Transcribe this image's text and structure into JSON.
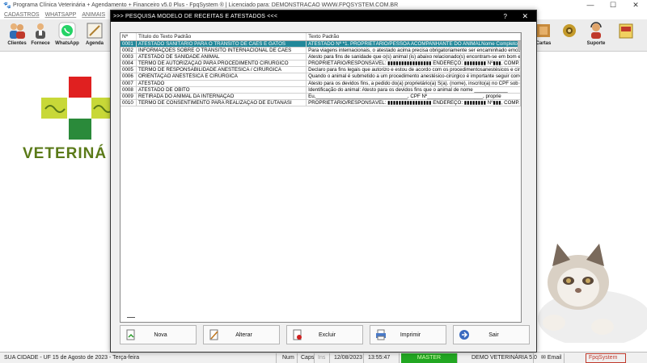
{
  "window": {
    "title": "Programa Clínica Veterinária + Agendamento + Financeiro v5.0 Plus - FpqSystem ® | Licenciado para: DEMONSTRACAO WWW.FPQSYSTEM.COM.BR",
    "minimize": "—",
    "maximize": "☐",
    "close": "✕"
  },
  "menu": [
    "CADASTROS",
    "WHATSAPP",
    "ANIMAIS"
  ],
  "toolbar": {
    "clientes": "Clientes",
    "fornece": "Fornece",
    "whatsapp": "WhatsApp",
    "agenda": "Agenda",
    "cartas": "Cartas",
    "suporte": "Suporte"
  },
  "logo": {
    "text": "VETERINÁ"
  },
  "dialog": {
    "title": ">>>  PESQUISA MODELO DE RECEITAS E ATESTADOS  <<<",
    "help": "?",
    "close": "✕",
    "columns": {
      "num": "Nº",
      "title": "Título do Texto Padrão",
      "text": "Texto Padrão"
    },
    "rows": [
      {
        "num": "0001",
        "title": "ATESTADO SANITÁRIO PARA O TRÂNSITO DE CÃES E GATOS",
        "text": "ATESTADO Nº *1. PROPRIETÁRIO/PESSOA ACOMPANHANTE DO ANIMALNome Completo"
      },
      {
        "num": "0002",
        "title": "INFORMAÇÕES SOBRE O TRÂNSITO INTERNACIONAL DE CÃES",
        "text": "Para viagens internacionais, o atestado acima precisa obrigatoriamente ser encaminhado emcon"
      },
      {
        "num": "0003",
        "title": "ATESTADO DE SANIDADE ANIMAL",
        "text": "Atesto para fins de sanidade que o(s) animal (is) abaixo relacionado(s) encontram-se em bom est"
      },
      {
        "num": "0004",
        "title": "TERMO DE AUTORIZAÇÃO PARA PROCEDIMENTO CIRÚRGICO",
        "text": "PROPRIETÁRIO/RESPONSÁVEL: ▮▮▮▮▮▮▮▮▮▮▮▮▮▮▮▮ ENDEREÇO: ▮▮▮▮▮▮▮▮ Nº▮▮▮, COMP.: ▮▮▮. CI"
      },
      {
        "num": "0005",
        "title": "TERMO DE RESPONSABILIDADE ANESTÉSICA / CIRÚRGICA",
        "text": "Declaro para fins legais que autorizo e estou de acordo com os procedimentosanestésicos e cirú"
      },
      {
        "num": "0006",
        "title": "ORIENTAÇÃO ANESTÉSICA E CIRÚRGICA",
        "text": "Quando o animal é submetido a um procedimento anestésico-cirúrgico é importante seguir corret"
      },
      {
        "num": "0007",
        "title": "ATESTADO",
        "text": "Atesto para os devidos fins, a pedido do(a) proprietário(a) S(a). (nome), inscrito(a) no CPF sob o"
      },
      {
        "num": "0008",
        "title": "ATESTADO DE ÓBITO",
        "text": "Identificação do animal: Atesto para os devidos fins que o animal de nome ____________"
      },
      {
        "num": "0009",
        "title": "RETIRADA DO ANIMAL DA INTERNAÇÃO",
        "text": "Eu,_________________________________, CPF Nº____________________, proprie"
      },
      {
        "num": "0010",
        "title": "TERMO DE CONSENTIMENTO PARA REALIZAÇÃO DE EUTANÁSI",
        "text": "PROPRIETÁRIO/RESPONSÁVEL: ▮▮▮▮▮▮▮▮▮▮▮▮▮▮▮▮ ENDEREÇO: ▮▮▮▮▮▮▮▮ Nº▮▮▮, COMP.: ▮▮▮. CI"
      }
    ],
    "buttons": {
      "nova": "Nova",
      "alterar": "Alterar",
      "excluir": "Excluir",
      "imprimir": "Imprimir",
      "sair": "Sair"
    }
  },
  "status": {
    "city": "SUA CIDADE - UF 15 de Agosto de 2023 - Terça-feira",
    "num": "Num",
    "caps": "Caps",
    "ins": "Ins",
    "date": "12/08/2023",
    "time": "13:55:47",
    "master": "MASTER",
    "demo": "DEMO VETERINÁRIA 5.0",
    "email": "Email",
    "brand": "FpqSystem"
  },
  "colors": {
    "selected_row": "#22889a",
    "master_green": "#22a722",
    "brand_red": "#c0392b",
    "logo_green": "#5a7a18"
  }
}
